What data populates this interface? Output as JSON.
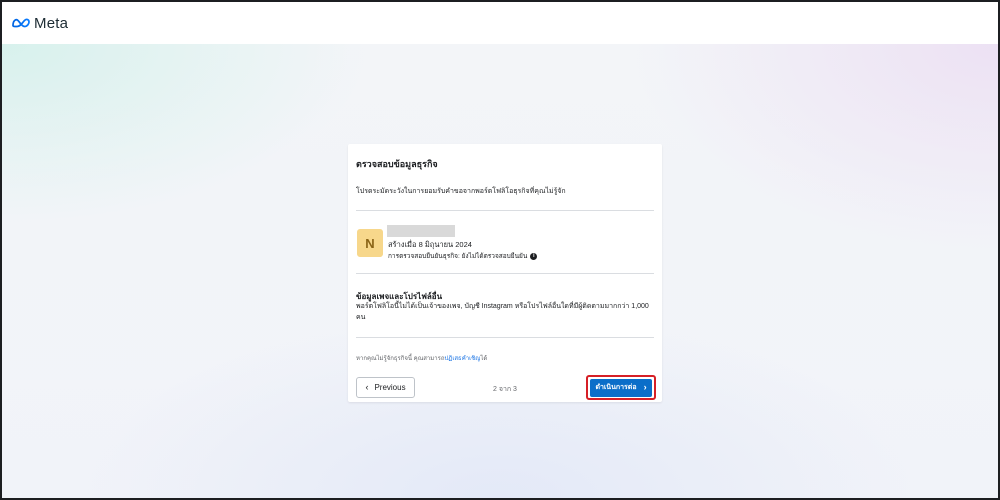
{
  "header": {
    "logo_text": "Meta"
  },
  "card": {
    "title": "ตรวจสอบข้อมูลธุรกิจ",
    "description": "โปรดระมัดระวังในการยอมรับคำขอจากพอร์ตโฟลิโอธุรกิจที่คุณไม่รู้จัก",
    "business": {
      "avatar_letter": "N",
      "created": "สร้างเมื่อ 8 มิถุนายน 2024",
      "verification": "การตรวจสอบยืนยันธุรกิจ: ยังไม่ได้ตรวจสอบยืนยัน"
    },
    "section": {
      "title": "ข้อมูลเพจและโปรไฟล์อื่น",
      "text": "พอร์ตโฟลิโอนี้ไม่ได้เป็นเจ้าของเพจ, บัญชี Instagram หรือโปรไฟล์อื่นใดที่มีผู้ติดตามมากกว่า 1,000 คน"
    },
    "report": {
      "prefix": "หากคุณไม่รู้จักธุรกิจนี้ คุณสามารถ",
      "link": "ปฏิเสธคำเชิญ",
      "suffix": "ได้"
    },
    "footer": {
      "previous_label": "Previous",
      "pager": "2 จาก 3",
      "continue_label": "ดำเนินการต่อ"
    }
  },
  "colors": {
    "primary_button": "#0b6ec9",
    "highlight_border": "#d61f26",
    "avatar_bg": "#f7d78b",
    "link": "#1b74e4"
  },
  "icons": {
    "logo": "meta-infinity-icon",
    "info": "info-icon",
    "prev": "chevron-left-icon",
    "next": "chevron-right-icon"
  }
}
